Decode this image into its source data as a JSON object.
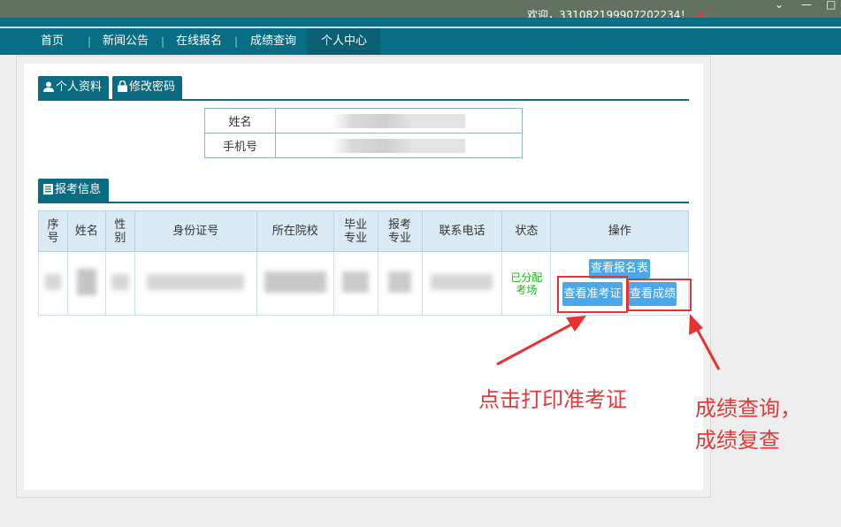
{
  "topbar": {
    "welcome": "欢迎，33108219990720223​4！",
    "logout": "退出"
  },
  "nav": {
    "items": [
      "首页",
      "新闻公告",
      "在线报名",
      "成绩查询",
      "个人中心"
    ],
    "separator": "|"
  },
  "tabs": {
    "profile": "个人资料",
    "password": "修改密码",
    "exam_info": "报考信息"
  },
  "profile": {
    "name_label": "姓名",
    "phone_label": "手机号"
  },
  "table": {
    "headers": [
      "序号",
      "姓名",
      "性别",
      "身份证号",
      "所在院校",
      "毕业专业",
      "报考专业",
      "联系电话",
      "状态",
      "操作"
    ],
    "row": {
      "status": "已分配考场"
    }
  },
  "buttons": {
    "view_form": "查看报名表",
    "view_ticket": "查看准考证",
    "view_score": "查看成绩"
  },
  "annotations": {
    "print_ticket": "点击打印准考证",
    "score_line1": "成绩查询，",
    "score_line2": "成绩复查"
  },
  "colors": {
    "nav_bg": "#086e86",
    "accent_button": "#4aa7ea",
    "annotation_red": "#e23a3a",
    "status_green": "#17b317"
  }
}
